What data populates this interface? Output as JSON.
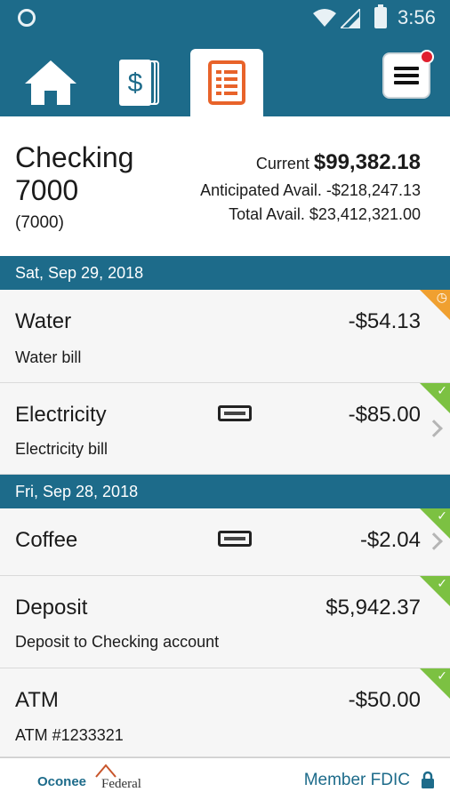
{
  "status_bar": {
    "time": "3:56"
  },
  "nav": {
    "tabs": [
      {
        "name": "home",
        "icon": "home-icon"
      },
      {
        "name": "accounts",
        "icon": "dollar-cards-icon"
      },
      {
        "name": "activity",
        "icon": "document-list-icon",
        "active": true
      }
    ],
    "menu_icon": "hamburger-menu-icon"
  },
  "account": {
    "name": "Checking 7000",
    "sub": "(7000)",
    "current_label": "Current",
    "current_value": "$99,382.18",
    "anticipated": "Anticipated Avail. -$218,247.13",
    "total": "Total Avail. $23,412,321.00"
  },
  "groups": [
    {
      "date": "Sat, Sep 29, 2018",
      "transactions": [
        {
          "name": "Water",
          "desc": "Water bill",
          "amount": "-$54.13",
          "status": "pending"
        },
        {
          "name": "Electricity",
          "desc": "Electricity bill",
          "amount": "-$85.00",
          "status": "cleared"
        }
      ]
    },
    {
      "date": "Fri, Sep 28, 2018",
      "transactions": [
        {
          "name": "Coffee",
          "desc": "",
          "amount": "-$2.04",
          "status": "cleared"
        },
        {
          "name": "Deposit",
          "desc": "Deposit to Checking account",
          "amount": "$5,942.37",
          "status": "cleared"
        },
        {
          "name": "ATM",
          "desc": "ATM #1233321",
          "amount": "-$50.00",
          "status": "cleared"
        }
      ]
    }
  ],
  "footer": {
    "logo_word1": "Oconee",
    "logo_word2": "Federal",
    "fdic": "Member FDIC"
  },
  "colors": {
    "brand": "#1d6b8a",
    "cleared": "#7cc142",
    "pending": "#f0a030",
    "badge": "#e0202f"
  }
}
